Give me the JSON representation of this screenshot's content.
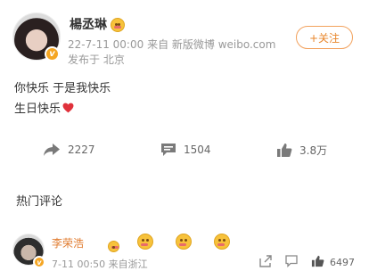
{
  "post": {
    "author": "楊丞琳",
    "time": "22-7-11 00:00",
    "source": "来自 新版微博 weibo.com",
    "location": "发布于 北京",
    "follow_label": "+关注",
    "lines": [
      "你快乐 于是我快乐",
      "生日快乐"
    ]
  },
  "actions": {
    "repost_count": "2227",
    "comment_count": "1504",
    "like_count": "3.8万"
  },
  "section_title": "热门评论",
  "comment": {
    "author": "李荣浩",
    "time": "7-11 00:50",
    "source": "来自浙江",
    "likes": "6497"
  },
  "colors": {
    "accent": "#e8862a",
    "heart": "#e0313b",
    "badge": "#f5a623"
  }
}
